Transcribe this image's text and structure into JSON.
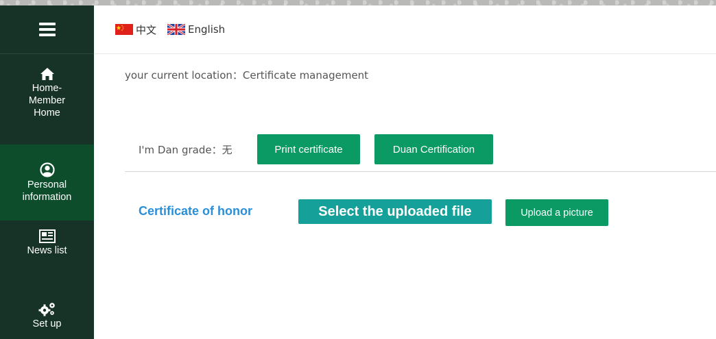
{
  "sidebar": {
    "menu_icon": "hamburger-menu-icon",
    "items": [
      {
        "label_line1": "Home-",
        "label_line2": "Member",
        "label_line3": "Home",
        "icon": "home-icon"
      },
      {
        "label_line1": "Personal",
        "label_line2": "information",
        "icon": "user-circle-icon",
        "active": true
      },
      {
        "label": "News list",
        "icon": "newspaper-icon"
      },
      {
        "label": "Set up",
        "icon": "gears-icon"
      }
    ],
    "bg_color": "#173226",
    "active_color": "#0e4d2c"
  },
  "topbar": {
    "languages": [
      {
        "label": "中文",
        "flag": "china-flag-icon"
      },
      {
        "label": "English",
        "flag": "uk-flag-icon"
      }
    ]
  },
  "main": {
    "location": "your current location：Certificate management",
    "grade_label": "I'm Dan grade：无",
    "print_button": "Print certificate",
    "duan_button": "Duan Certification",
    "honor_title": "Certificate of honor",
    "select_file_button": "Select the uploaded file",
    "upload_button": "Upload a picture"
  },
  "colors": {
    "primary_green": "#0b9a64",
    "teal": "#16a09a",
    "honor_blue": "#2b8fd8"
  }
}
